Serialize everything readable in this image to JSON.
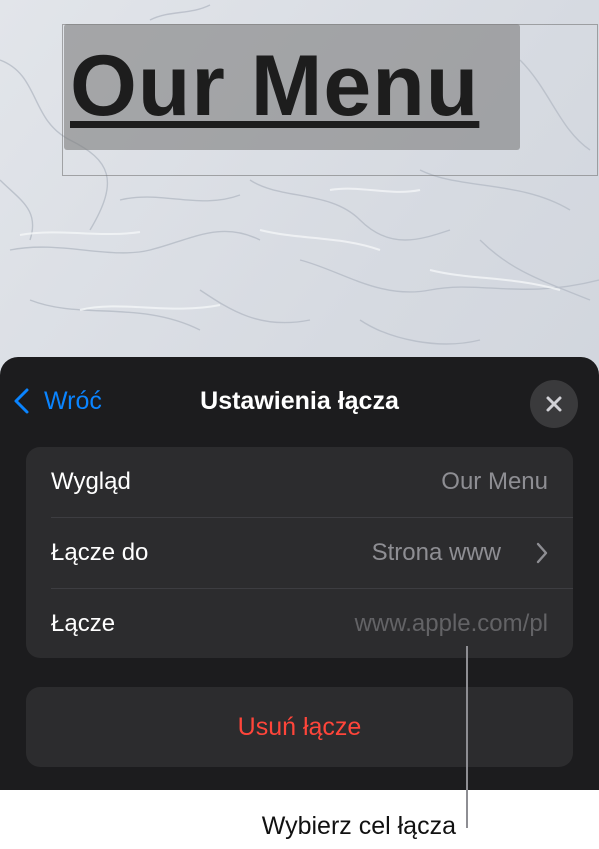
{
  "slide": {
    "title_text": "Our Menu"
  },
  "sheet": {
    "back_label": "Wróć",
    "title": "Ustawienia łącza",
    "close_icon": "xmark-icon",
    "back_icon": "chevron-left-icon",
    "rows": [
      {
        "label": "Wygląd",
        "value": "Our Menu"
      },
      {
        "label": "Łącze do",
        "value": "Strona www",
        "chevron_icon": "chevron-right-icon"
      },
      {
        "label": "Łącze",
        "placeholder": "www.apple.com/pl"
      }
    ],
    "remove_label": "Usuń łącze"
  },
  "callout": {
    "text": "Wybierz cel łącza"
  },
  "colors": {
    "accent_blue": "#0a84ff",
    "destructive_red": "#ff453a",
    "sheet_background": "#1c1c1e",
    "group_background": "#2c2c2e"
  }
}
